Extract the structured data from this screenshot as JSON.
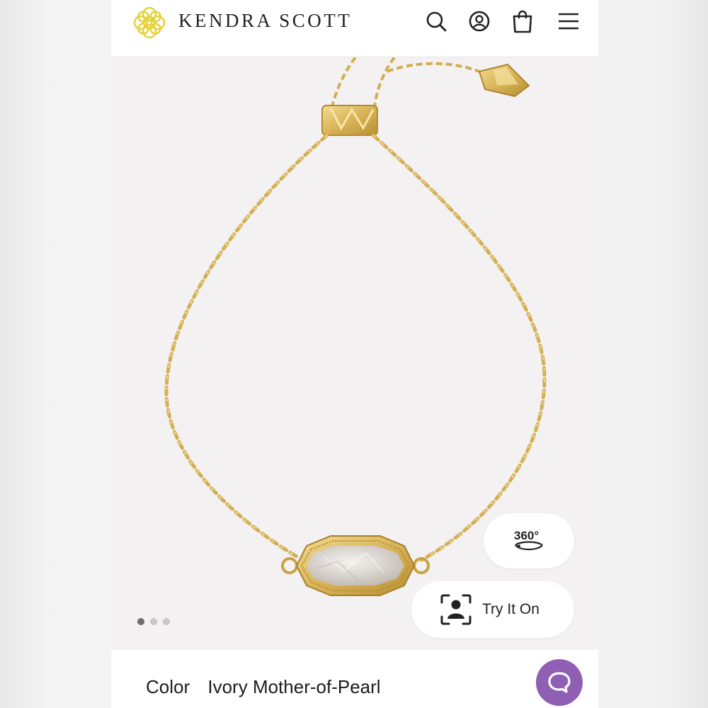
{
  "header": {
    "brand": "KENDRA SCOTT",
    "logo_icon": "kendra-scott-medallion-icon",
    "actions": [
      {
        "name": "search",
        "icon": "search-icon"
      },
      {
        "name": "account",
        "icon": "account-icon"
      },
      {
        "name": "cart",
        "icon": "shopping-bag-icon"
      },
      {
        "name": "menu",
        "icon": "hamburger-menu-icon"
      }
    ],
    "brand_color": "#e4d23a"
  },
  "gallery": {
    "image_count": 3,
    "active_index": 0,
    "view_360_label": "360°",
    "try_on_label": "Try It On"
  },
  "product": {
    "color_label": "Color",
    "color_value": "Ivory Mother-of-Pearl"
  },
  "chat": {
    "icon": "chat-bubble-icon",
    "color": "#8e5fb2"
  }
}
